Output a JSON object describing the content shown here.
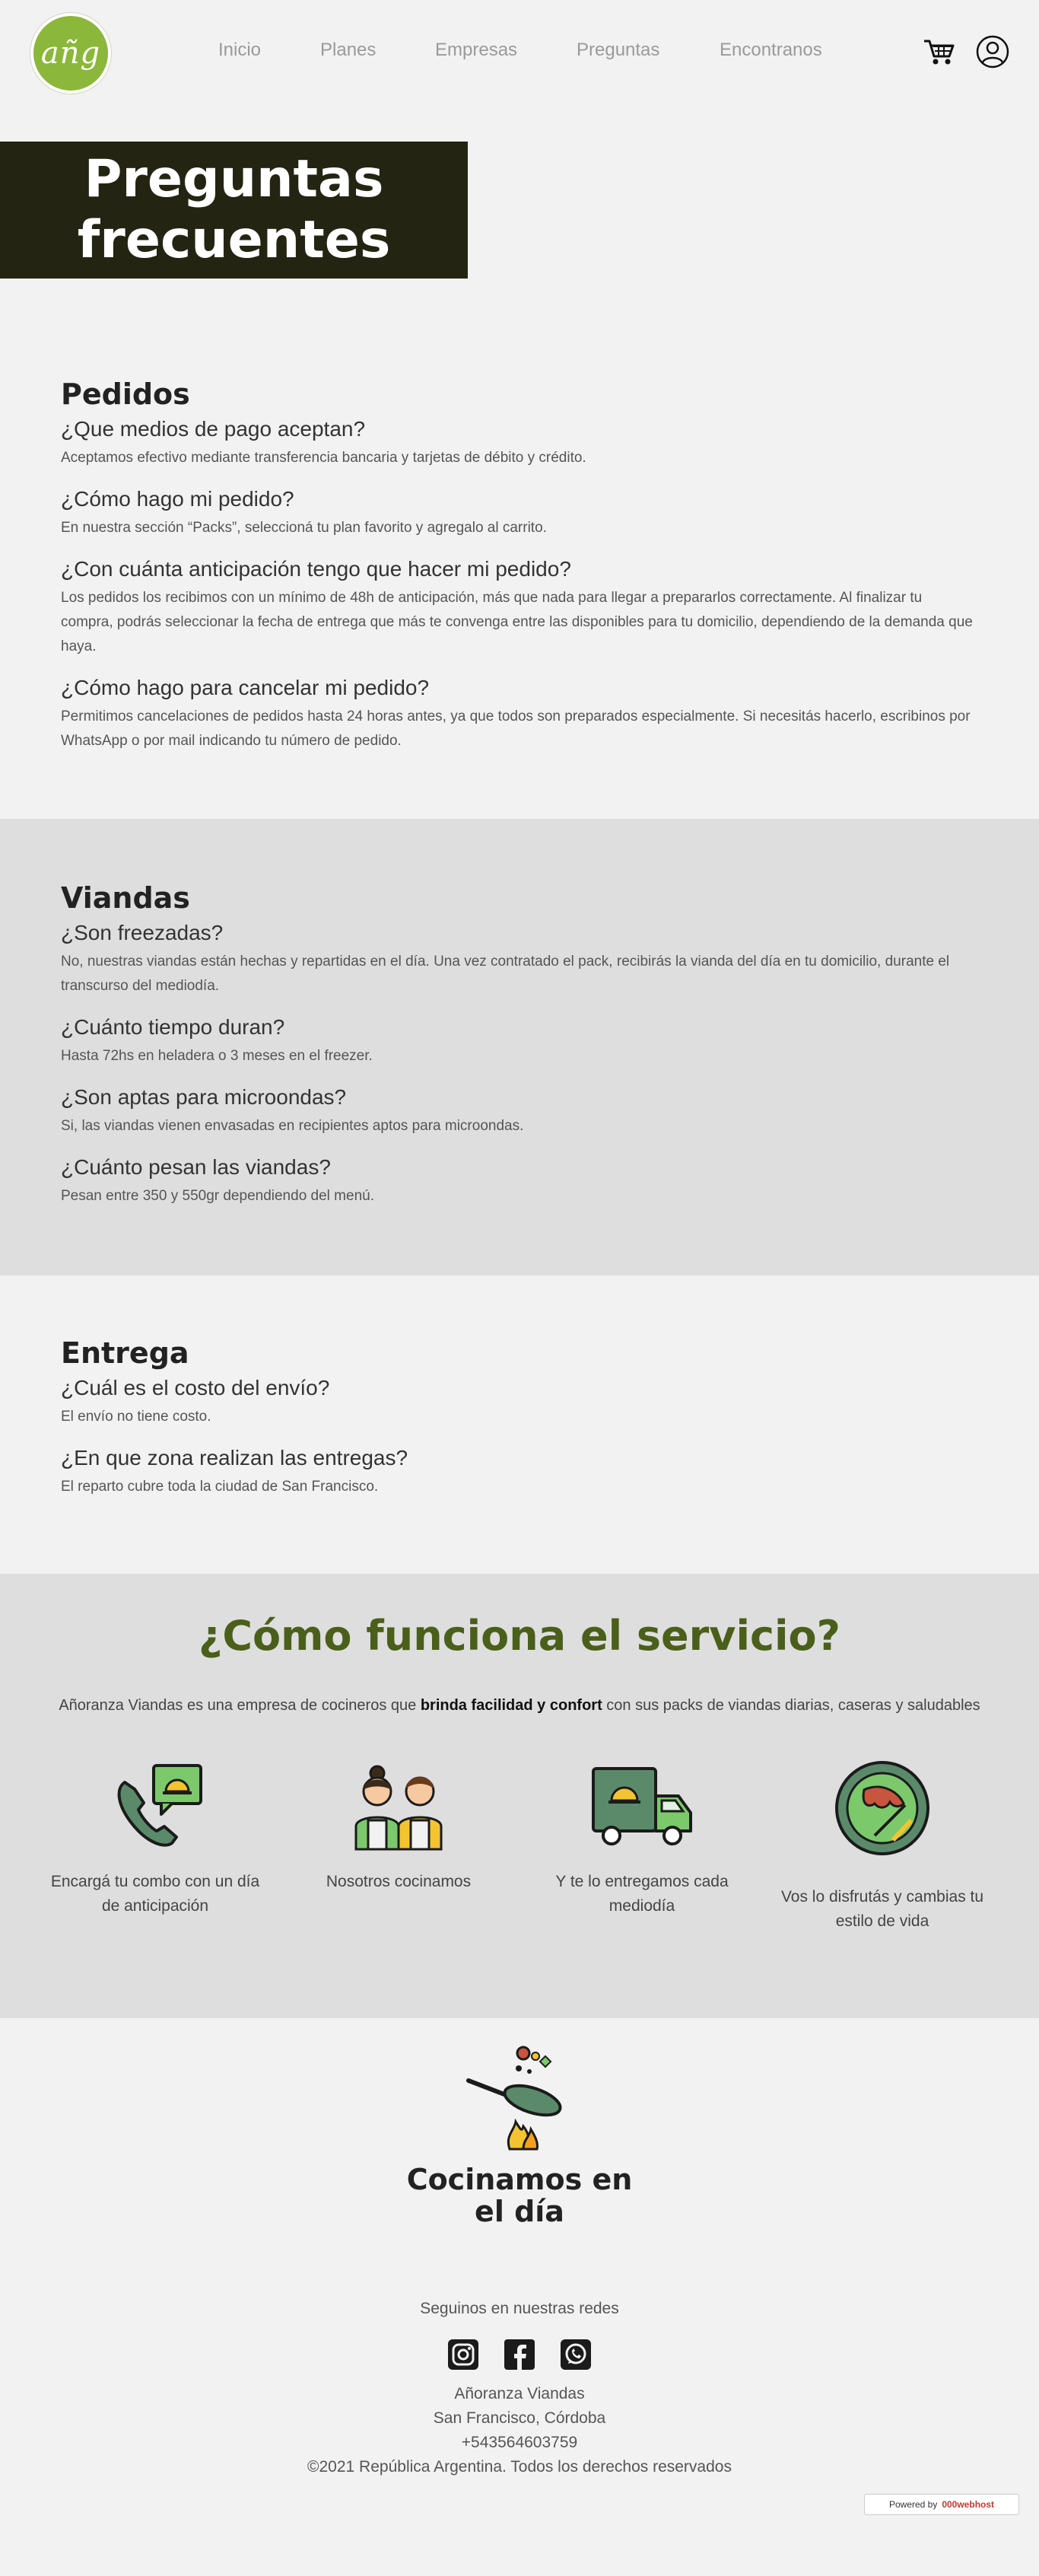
{
  "header": {
    "logo_text": "añg",
    "nav": [
      "Inicio",
      "Planes",
      "Empresas",
      "Preguntas",
      "Encontranos"
    ]
  },
  "page_title": "Preguntas frecuentes",
  "sections": [
    {
      "title": "Pedidos",
      "items": [
        {
          "q": "¿Que medios de pago aceptan?",
          "a": "Aceptamos efectivo mediante transferencia bancaria y tarjetas de débito y crédito."
        },
        {
          "q": "¿Cómo hago mi pedido?",
          "a": "En nuestra sección “Packs”, seleccioná tu plan favorito y agregalo al carrito."
        },
        {
          "q": "¿Con cuánta anticipación tengo que hacer mi pedido?",
          "a": "Los pedidos los recibimos con un mínimo de 48h de anticipación, más que nada para llegar a prepararlos correctamente. Al finalizar tu compra, podrás seleccionar la fecha de entrega que más te convenga entre las disponibles para tu domicilio, dependiendo de la demanda que haya."
        },
        {
          "q": "¿Cómo hago para cancelar mi pedido?",
          "a": "Permitimos cancelaciones de pedidos hasta 24 horas antes, ya que todos son preparados especialmente. Si necesitás hacerlo, escribinos por WhatsApp o por mail indicando tu número de pedido."
        }
      ]
    },
    {
      "title": "Viandas",
      "items": [
        {
          "q": "¿Son freezadas?",
          "a": "No, nuestras viandas están hechas y repartidas en el día. Una vez contratado el pack, recibirás la vianda del día en tu domicilio, durante el transcurso del mediodía."
        },
        {
          "q": "¿Cuánto tiempo duran?",
          "a": "Hasta 72hs en heladera o 3 meses en el freezer."
        },
        {
          "q": "¿Son aptas para microondas?",
          "a": "Si, las viandas vienen envasadas en recipientes aptos para microondas."
        },
        {
          "q": "¿Cuánto pesan las viandas?",
          "a": "Pesan entre 350 y 550gr dependiendo del menú."
        }
      ]
    },
    {
      "title": "Entrega",
      "items": [
        {
          "q": "¿Cuál es el costo del envío?",
          "a": "El envío no tiene costo."
        },
        {
          "q": "¿En que zona realizan las entregas?",
          "a": "El reparto cubre toda la ciudad de San Francisco."
        }
      ]
    }
  ],
  "how": {
    "title": "¿Cómo funciona el servicio?",
    "intro_pre": "Añoranza Viandas es una empresa de cocineros que ",
    "intro_bold": "brinda facilidad y confort",
    "intro_post": " con sus packs de viandas diarias, caseras y saludables",
    "steps": [
      "Encargá tu combo con un día de anticipación",
      "Nosotros cocinamos",
      "Y te lo entregamos cada mediodía",
      "Vos lo disfrutás y cambias tu estilo de vida"
    ]
  },
  "cook_text": "Cocinamos en el día",
  "footer": {
    "follow": "Seguinos en nuestras redes",
    "company": "Añoranza Viandas",
    "city": "San Francisco, Córdoba",
    "phone": "+543564603759",
    "copyright": "©2021 República Argentina. Todos los derechos reservados"
  },
  "powered": {
    "label": "Powered by",
    "brand": "000webhost"
  },
  "colors": {
    "dark": "#232512",
    "accent": "#4a5f1a",
    "logo": "#8bb73a",
    "gray_band": "#dedede"
  }
}
